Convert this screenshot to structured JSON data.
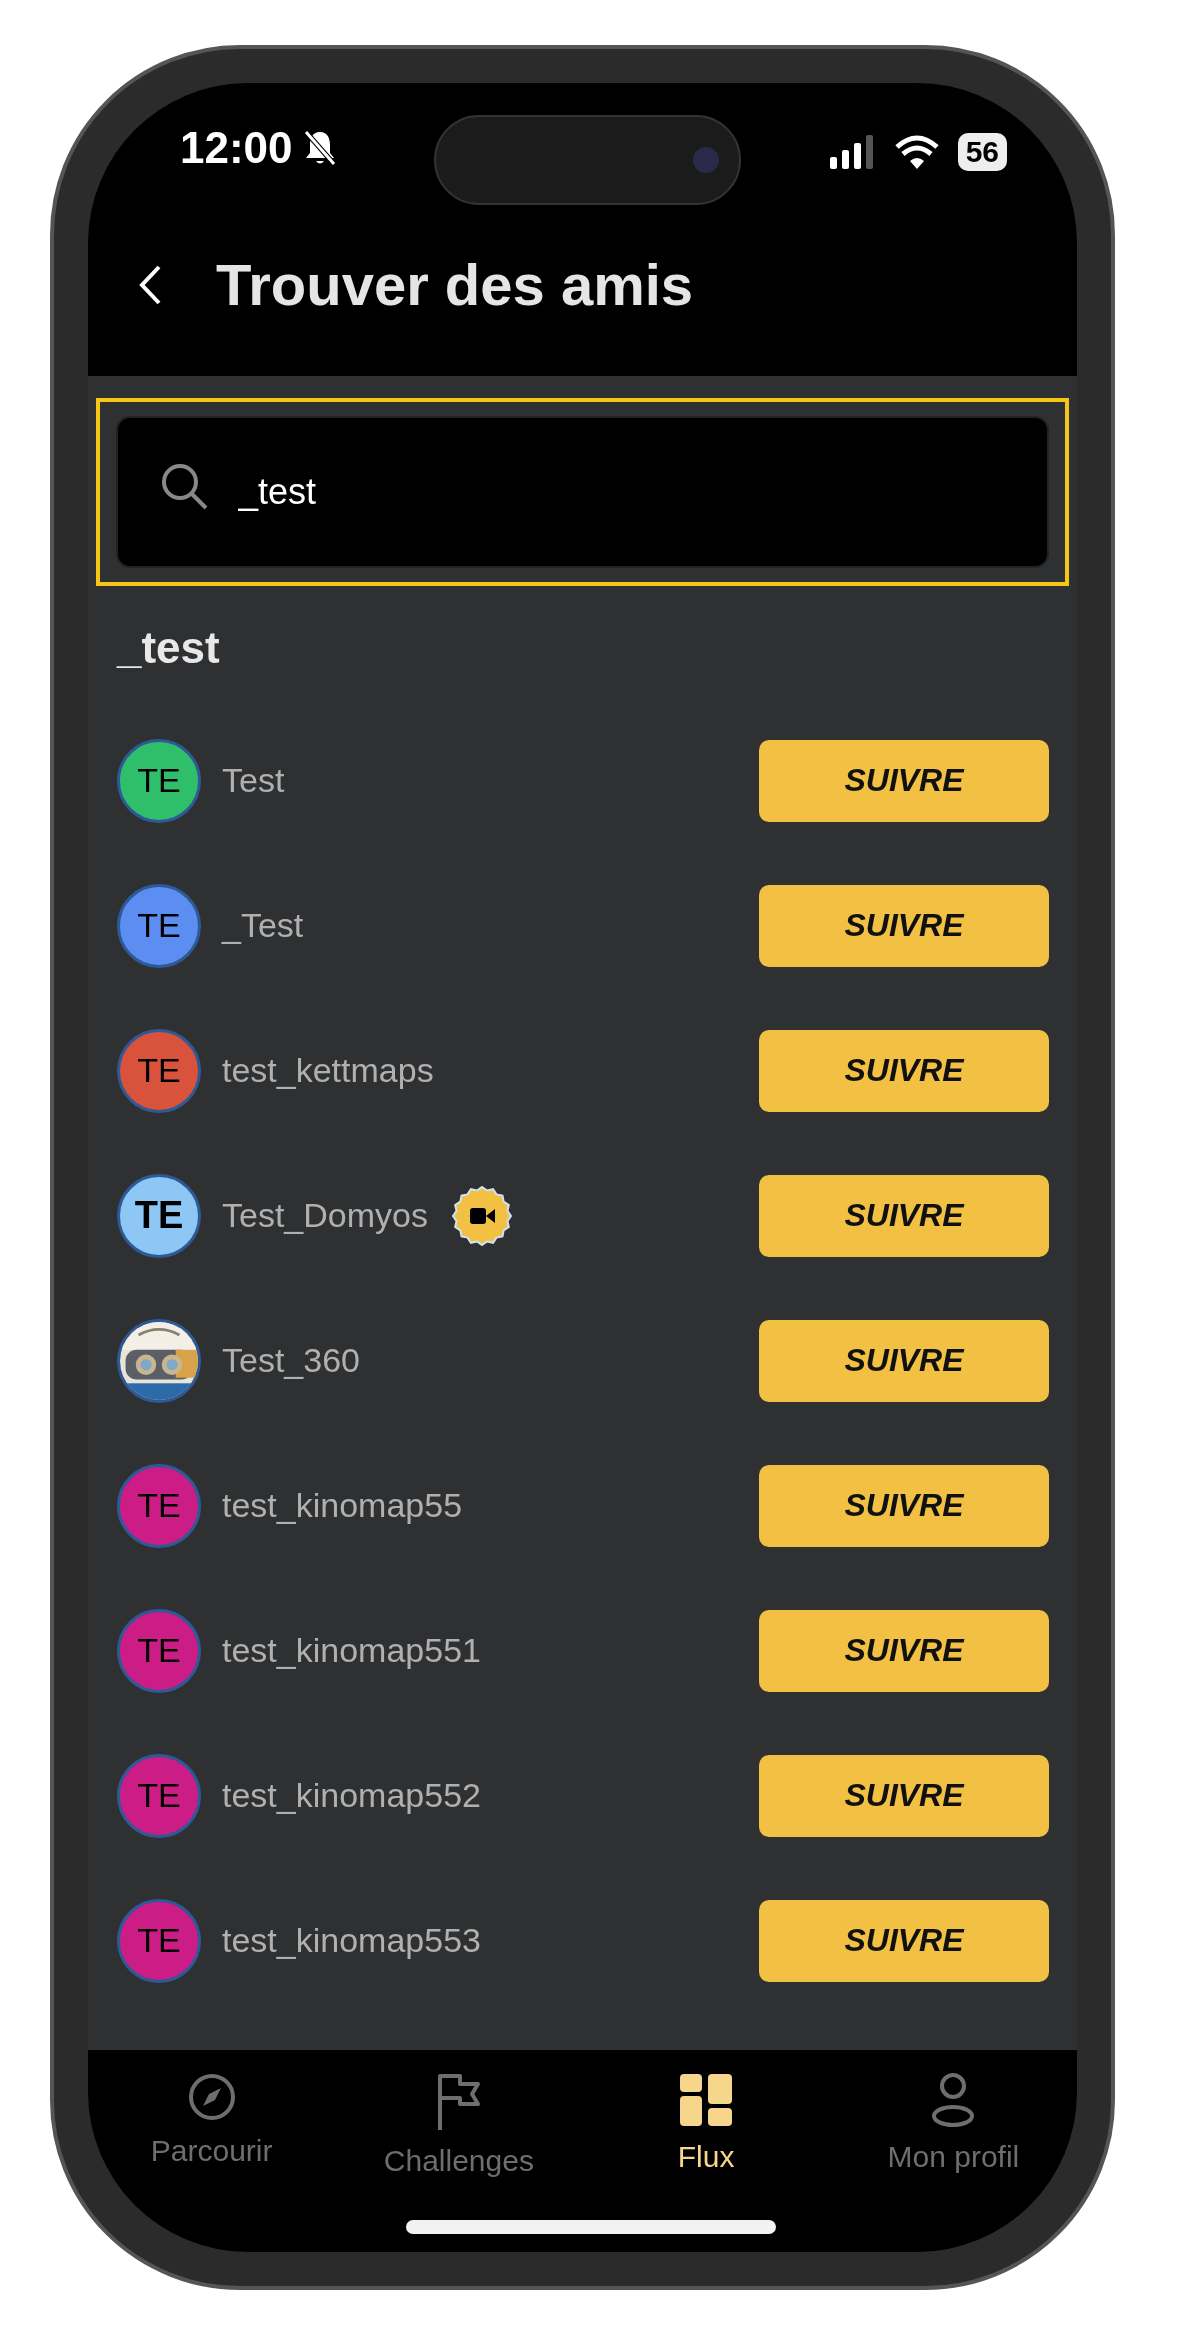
{
  "status_bar": {
    "time": "12:00",
    "battery": "56"
  },
  "header": {
    "title": "Trouver des amis"
  },
  "search": {
    "value": "_test",
    "focused": true
  },
  "section_title": "_test",
  "users": [
    {
      "name": "Test",
      "avatar": {
        "kind": "initials",
        "initials": "TE",
        "color": "#2fbf6a"
      },
      "badge": false,
      "button": "SUIVRE"
    },
    {
      "name": "_Test",
      "avatar": {
        "kind": "initials",
        "initials": "TE",
        "color": "#5b8ef0"
      },
      "badge": false,
      "button": "SUIVRE"
    },
    {
      "name": "test_kettmaps",
      "avatar": {
        "kind": "initials",
        "initials": "TE",
        "color": "#d9523b"
      },
      "badge": false,
      "button": "SUIVRE"
    },
    {
      "name": "Test_Domyos",
      "avatar": {
        "kind": "initials",
        "initials": "TE",
        "color": "#8ec7f5",
        "bold": true
      },
      "badge": true,
      "button": "SUIVRE"
    },
    {
      "name": "Test_360",
      "badge": false,
      "button": "SUIVRE"
    },
    {
      "name": "test_kinomap55",
      "avatar": {
        "kind": "initials",
        "initials": "TE",
        "color": "#cc1d86"
      },
      "badge": false,
      "button": "SUIVRE"
    },
    {
      "name": "test_kinomap551",
      "avatar": {
        "kind": "initials",
        "initials": "TE",
        "color": "#cc1d86"
      },
      "badge": false,
      "button": "SUIVRE"
    },
    {
      "name": "test_kinomap552",
      "avatar": {
        "kind": "initials",
        "initials": "TE",
        "color": "#cc1d86"
      },
      "badge": false,
      "button": "SUIVRE"
    },
    {
      "name": "test_kinomap553",
      "avatar": {
        "kind": "initials",
        "initials": "TE",
        "color": "#cc1d86"
      },
      "badge": false,
      "button": "SUIVRE"
    }
  ],
  "tabs": [
    {
      "label": "Parcourir",
      "kind": "compass",
      "selected": false
    },
    {
      "label": "Challenges",
      "kind": "flag",
      "selected": false
    },
    {
      "label": "Flux",
      "kind": "grid",
      "selected": true
    },
    {
      "label": "Mon profil",
      "kind": "person",
      "selected": false
    }
  ]
}
